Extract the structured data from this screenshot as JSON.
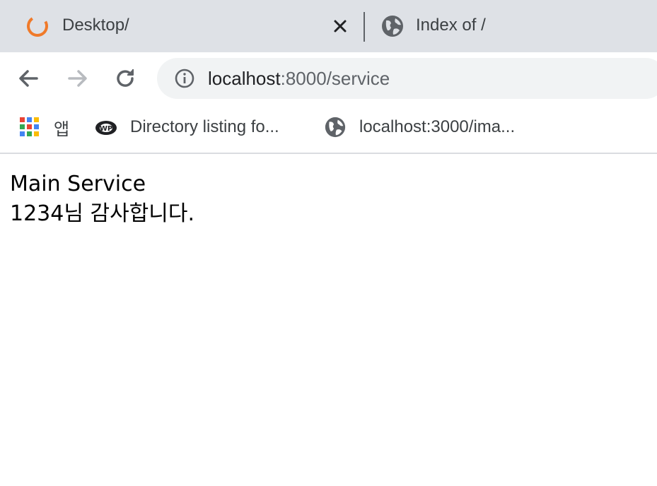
{
  "tabs": [
    {
      "title": "Desktop/",
      "active": true,
      "favicon": "orange-ring-icon"
    },
    {
      "title": "Index of /",
      "active": false,
      "favicon": "globe-icon"
    }
  ],
  "toolbar": {
    "url_host": "localhost",
    "url_rest": ":8000/service"
  },
  "bookmarks": [
    {
      "label": "앱",
      "icon": "apps-grid-icon"
    },
    {
      "label": "Directory listing fo...",
      "icon": "ie-logo-icon"
    },
    {
      "label": "localhost:3000/ima...",
      "icon": "globe-icon"
    }
  ],
  "page": {
    "line1": "Main Service",
    "line2": "1234님 감사합니다."
  },
  "colors": {
    "tabstrip": "#dee1e6",
    "omnibox": "#f1f3f4",
    "accent_orange": "#f07a2a"
  }
}
